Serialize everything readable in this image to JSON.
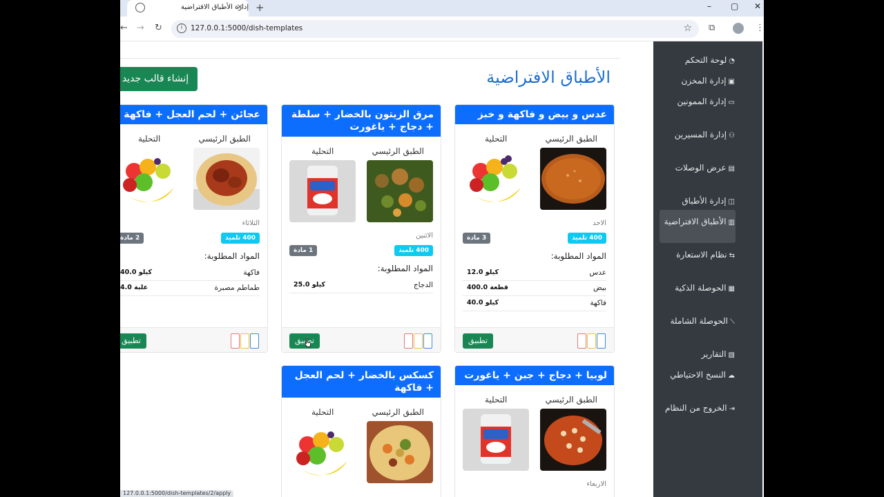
{
  "browser": {
    "tab_title": "إدارة الأطباق الافتراضية",
    "tab_close": "×",
    "new_tab": "+",
    "url": "127.0.0.1:5000/dish-templates",
    "status_url": "127.0.0.1:5000/dish-templates/2/apply",
    "min": "–",
    "max": "▢",
    "close": "✕"
  },
  "sidebar": {
    "items": [
      {
        "label": "لوحة التحكم",
        "icon": "dashboard-icon"
      },
      {
        "label": "إدارة المخزن",
        "icon": "box-icon"
      },
      {
        "label": "إدارة الممونين",
        "icon": "truck-icon"
      },
      {
        "label": "إدارة المسيرين",
        "icon": "people-icon"
      },
      {
        "label": "عرض الوصلات",
        "icon": "receipt-icon"
      },
      {
        "label": "إدارة الأطباق",
        "icon": "cup-icon"
      },
      {
        "label": "الأطباق الافتراضية",
        "icon": "clipboard-icon"
      },
      {
        "label": "نظام الاستعارة",
        "icon": "exchange-icon"
      },
      {
        "label": "الحوصلة الذكية",
        "icon": "cpu-icon"
      },
      {
        "label": "الحوصلة الشاملة",
        "icon": "chart-icon"
      },
      {
        "label": "التقارير",
        "icon": "report-icon"
      },
      {
        "label": "النسخ الاحتياطي",
        "icon": "cloud-icon"
      },
      {
        "label": "الخروج من النظام",
        "icon": "logout-icon"
      }
    ]
  },
  "main": {
    "title": "الأطباق الافتراضية",
    "create_label": "إنشاء قالب جديد"
  },
  "labels": {
    "main_dish": "الطبق الرئيسي",
    "dessert": "التحلية",
    "required": "المواد المطلوبة:",
    "apply": "تطبيق"
  },
  "cards": [
    {
      "title": "عدس و بيض و فاكهة و خبز",
      "day": "الاحد",
      "students": "400 تلميذ",
      "count": "3 مادة",
      "items": [
        {
          "name": "عدس",
          "qty": "12.0 كيلو"
        },
        {
          "name": "بيض",
          "qty": "400.0 قطعة"
        },
        {
          "name": "فاكهة",
          "qty": "40.0 كيلو"
        }
      ]
    },
    {
      "title": "مرق الزيتون بالخضار + سلطة + دجاج + ياغورت",
      "day": "الاثنين",
      "students": "400 تلميذ",
      "count": "1 مادة",
      "items": [
        {
          "name": "الدجاج",
          "qty": "25.0 كيلو"
        }
      ]
    },
    {
      "title": "عجائن + لحم العجل + فاكهة",
      "day": "الثلاثاء",
      "students": "400 تلميذ",
      "count": "2 مادة",
      "items": [
        {
          "name": "فاكهة",
          "qty": "40.0 كيلو"
        },
        {
          "name": "طماطم مصبرة",
          "qty": "4.0 علبة"
        }
      ]
    },
    {
      "title": "لوبيا + دجاج + جبن + ياغورت",
      "day": "الاربعاء"
    },
    {
      "title": "كسكس بالخضار + لحم العجل + فاكهة"
    }
  ],
  "colors": {
    "sidebar_bg": "#343a40",
    "primary": "#0d6efd",
    "success": "#198754",
    "info": "#0dcaf0",
    "secondary": "#6c757d",
    "heading": "#1c6fd0"
  }
}
